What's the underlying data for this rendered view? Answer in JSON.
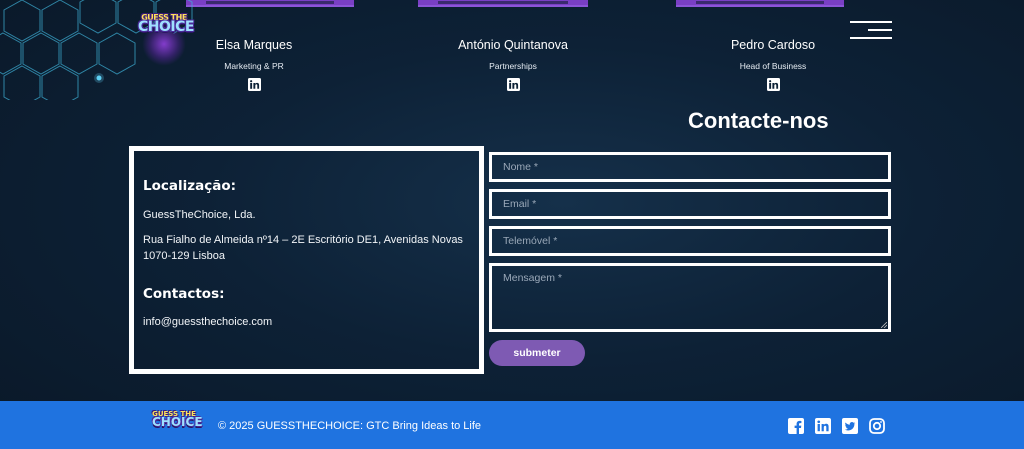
{
  "brand": {
    "logo_line1": "GUESS THE",
    "logo_line2": "CHOICE"
  },
  "team": [
    {
      "name": "Elsa Marques",
      "role": "Marketing & PR",
      "icon": "linkedin-icon"
    },
    {
      "name": "António Quintanova",
      "role": "Partnerships",
      "icon": "linkedin-icon"
    },
    {
      "name": "Pedro Cardoso",
      "role": "Head of Business",
      "icon": "linkedin-icon"
    }
  ],
  "contact": {
    "title": "Contacte-nos",
    "location_heading": "Localização:",
    "company": "GuessTheChoice, Lda.",
    "address_line1": "Rua Fialho de Almeida nº14 – 2E Escritório DE1, Avenidas Novas",
    "address_line2": "1070-129 Lisboa",
    "contacts_heading": "Contactos:",
    "email": "info@guessthechoice.com"
  },
  "form": {
    "name_placeholder": "Nome *",
    "email_placeholder": "Email *",
    "phone_placeholder": "Telemóvel *",
    "message_placeholder": "Mensagem *",
    "submit_label": "submeter"
  },
  "footer": {
    "copyright": "© 2025 GUESSTHECHOICE: GTC Bring Ideas to Life",
    "social_icons": [
      "facebook-icon",
      "linkedin-icon",
      "twitter-icon",
      "instagram-icon"
    ]
  },
  "colors": {
    "background": "#0d2136",
    "accent_purple": "#7e5ab3",
    "footer_blue": "#1f73e0",
    "logo_yellow": "#ffd400"
  }
}
